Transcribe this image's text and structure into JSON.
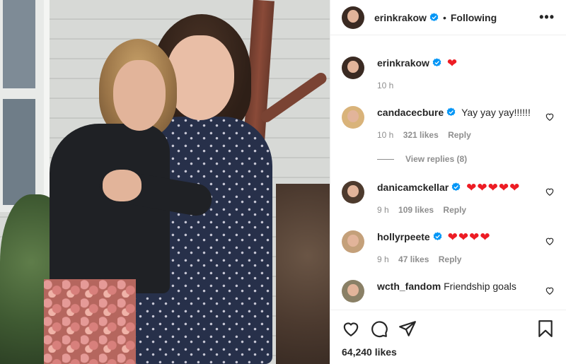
{
  "colors": {
    "verified": "#0095f6",
    "heart": "#ed1c24",
    "muted": "#8e8e8e",
    "text": "#262626"
  },
  "header": {
    "username": "erinkrakow",
    "separator": "•",
    "following_label": "Following",
    "more_label": "•••"
  },
  "caption": {
    "username": "erinkrakow",
    "text": "",
    "time": "10 h"
  },
  "comments": [
    {
      "username": "candacecbure",
      "text": "Yay yay yay!!!!!!",
      "hearts": 0,
      "time": "10 h",
      "likes": "321 likes",
      "reply": "Reply"
    },
    {
      "username": "danicamckellar",
      "text": "",
      "hearts": 5,
      "time": "9 h",
      "likes": "109 likes",
      "reply": "Reply"
    },
    {
      "username": "hollyrpeete",
      "text": "",
      "hearts": 4,
      "time": "9 h",
      "likes": "47 likes",
      "reply": "Reply"
    },
    {
      "username": "wcth_fandom",
      "text": "Friendship goals"
    }
  ],
  "view_replies": "View replies (8)",
  "likes_total": "64,240 likes",
  "icons": [
    "heart-outline-icon",
    "comment-icon",
    "share-icon",
    "bookmark-icon",
    "verified-badge-icon",
    "more-icon"
  ]
}
